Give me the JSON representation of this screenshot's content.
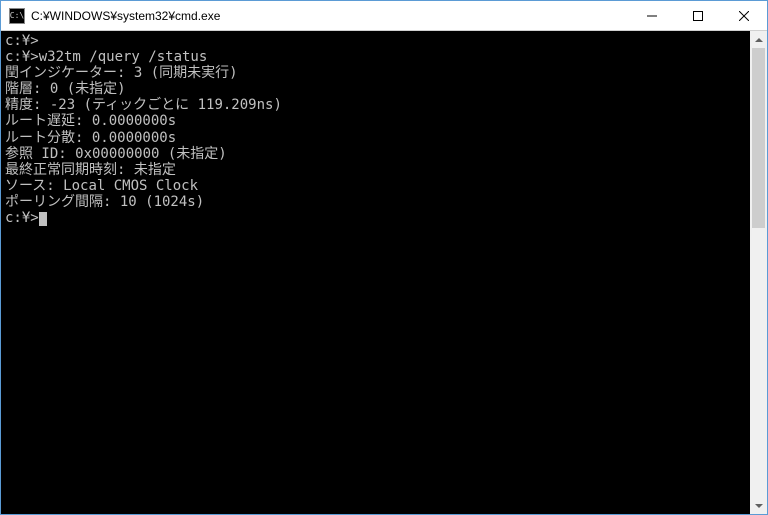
{
  "window": {
    "icon_text": "C:\\",
    "title": "C:¥WINDOWS¥system32¥cmd.exe"
  },
  "terminal": {
    "lines": [
      "c:¥>",
      "c:¥>w32tm /query /status",
      "閏インジケーター: 3 (同期未実行)",
      "階層: 0 (未指定)",
      "精度: -23 (ティックごとに 119.209ns)",
      "ルート遅延: 0.0000000s",
      "ルート分散: 0.0000000s",
      "参照 ID: 0x00000000 (未指定)",
      "最終正常同期時刻: 未指定",
      "ソース: Local CMOS Clock",
      "ポーリング間隔: 10 (1024s)",
      "",
      "c:¥>"
    ],
    "prompt_with_cursor_index": 12
  }
}
